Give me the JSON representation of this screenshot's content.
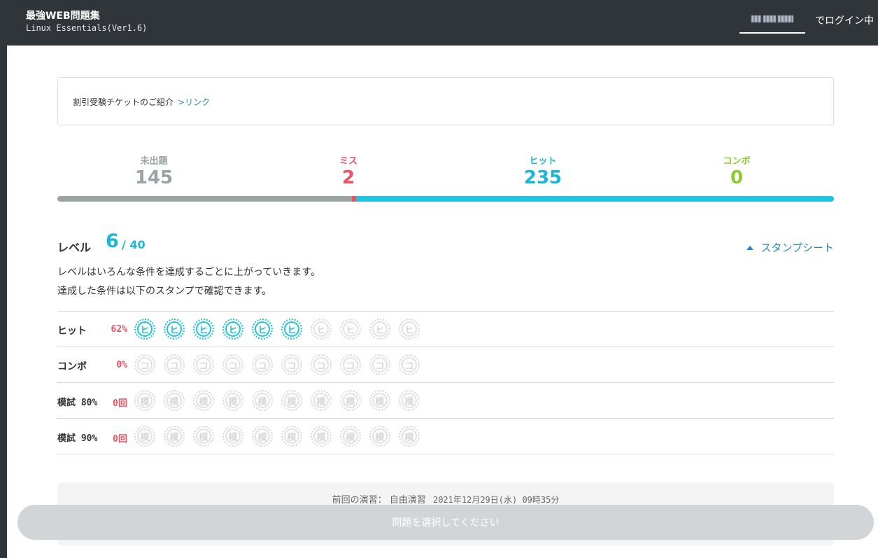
{
  "header": {
    "title": "最強WEB問題集",
    "subtitle": "Linux Essentials(Ver1.6)",
    "login_suffix": "でログイン中"
  },
  "notice": {
    "text": "割引受験チケットのご紹介",
    "link": ">リンク"
  },
  "stats": {
    "unasked": {
      "label": "未出題",
      "value": "145",
      "color": "#99a3a4"
    },
    "miss": {
      "label": "ミス",
      "value": "2",
      "color": "#ef5162"
    },
    "hit": {
      "label": "ヒット",
      "value": "235",
      "color": "#1ec4e0"
    },
    "combo": {
      "label": "コンボ",
      "value": "0",
      "color": "#8ccc2e"
    }
  },
  "level": {
    "label": "レベル",
    "current": "6",
    "total": "/ 40",
    "stamp_sheet_toggle": "スタンプシート",
    "desc_line1": "レベルはいろんな条件を達成するごとに上がっていきます。",
    "desc_line2": "達成した条件は以下のスタンプで確認できます。"
  },
  "stamp_rows": [
    {
      "name": "ヒット",
      "pct": "62%",
      "glyph": "ヒ",
      "achieved": 6,
      "total": 10
    },
    {
      "name": "コンボ",
      "pct": "0%",
      "glyph": "コ",
      "achieved": 0,
      "total": 10
    },
    {
      "name": "模試 80%",
      "pct": "0回",
      "glyph": "模",
      "achieved": 0,
      "total": 10
    },
    {
      "name": "模試 90%",
      "pct": "0回",
      "glyph": "模",
      "achieved": 0,
      "total": 10
    }
  ],
  "last_session": {
    "label": "前回の演習：",
    "mode": "自由演習",
    "datetime": "2021年12月29日(水) 09時35分"
  },
  "select_button": "問題を選択してください"
}
